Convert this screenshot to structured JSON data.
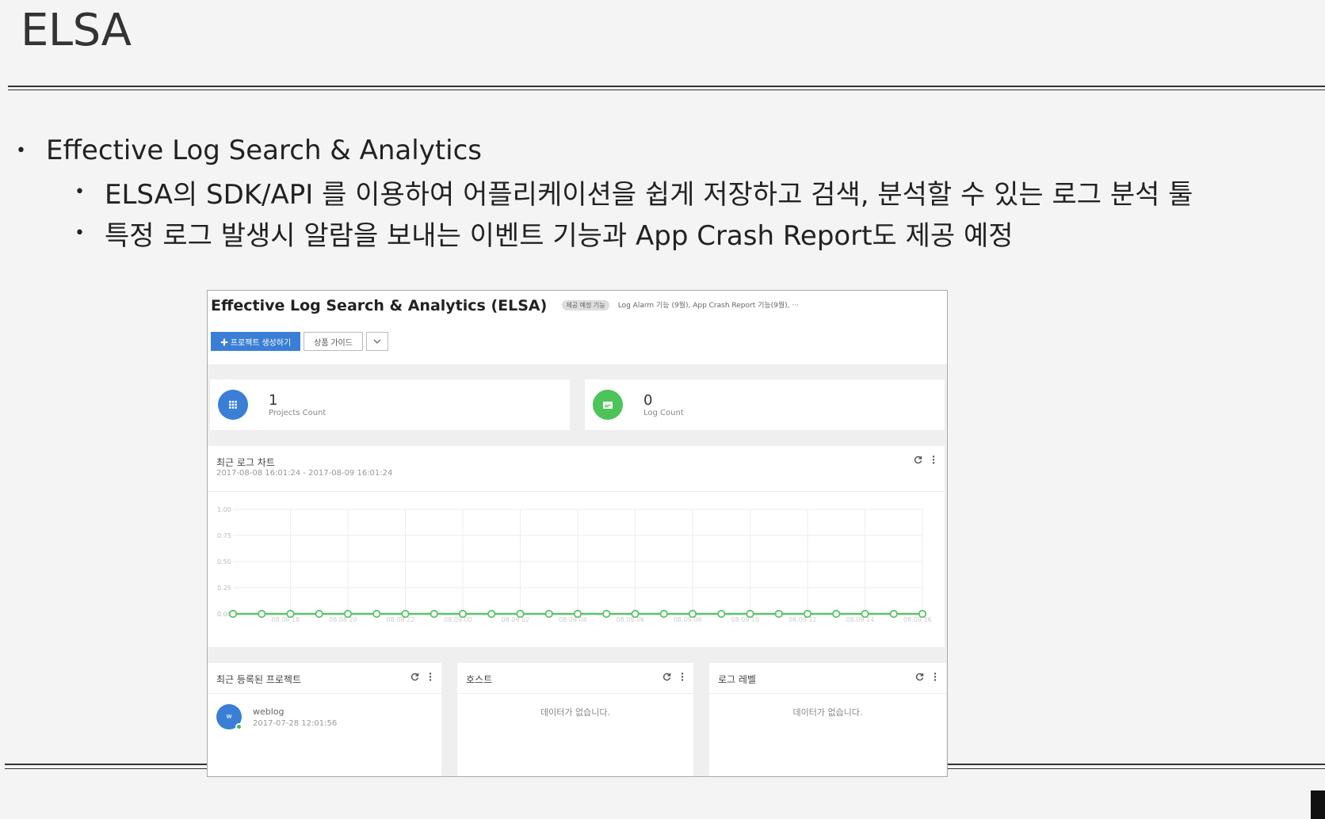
{
  "slide": {
    "title": "ELSA",
    "bullet_main": "Effective Log Search & Analytics",
    "bullet_subs": [
      "ELSA의 SDK/API 를 이용하여 어플리케이션을 쉽게 저장하고 검색, 분석할 수 있는 로그 분석 툴",
      "특정 로그 발생시 알람을 보내는 이벤트 기능과 App Crash Report도 제공 예정"
    ],
    "bullet_glyph": "•"
  },
  "screenshot": {
    "title": "Effective Log Search & Analytics (ELSA)",
    "tag": "제공 예정 기능",
    "note": "Log Alarm 기능 (9월), App Crash Report 기능(9월), ···",
    "create_button": "✚ 프로젝트 생성하기",
    "guide_button": "상품 가이드",
    "caret_icon": "chevron-down",
    "stats": [
      {
        "value": "1",
        "label": "Projects Count",
        "color": "#3a7fd5",
        "icon": "grid-icon"
      },
      {
        "value": "0",
        "label": "Log Count",
        "color": "#4cc45a",
        "icon": "log-icon"
      }
    ],
    "chart_card": {
      "title": "최근 로그 차트",
      "range": "2017-08-08 16:01:24 - 2017-08-09 16:01:24"
    },
    "bottom_cards": [
      {
        "title": "최근 등록된 프로젝트",
        "project": {
          "name": "weblog",
          "date": "2017-07-28 12:01:56",
          "avatar": "w"
        }
      },
      {
        "title": "호스트",
        "empty": "데이터가 없습니다."
      },
      {
        "title": "로그 레벨",
        "empty": "데이터가 없습니다."
      }
    ]
  },
  "chart_data": {
    "type": "line",
    "title": "최근 로그 차트",
    "ylim": [
      0,
      1
    ],
    "yticks": [
      "1.00",
      "0.75",
      "0.50",
      "0.25",
      "0.00"
    ],
    "xticks": [
      "08.08 18",
      "08.08 20",
      "08.08 22",
      "08.09 00",
      "08.09 02",
      "08.09 04",
      "08.09 06",
      "08.09 08",
      "08.09 10",
      "08.09 12",
      "08.09 14",
      "08.09 16"
    ],
    "series": [
      {
        "color": "#5cc26b",
        "values": [
          0,
          0,
          0,
          0,
          0,
          0,
          0,
          0,
          0,
          0,
          0,
          0,
          0,
          0,
          0,
          0,
          0,
          0,
          0,
          0,
          0,
          0,
          0,
          0,
          0
        ]
      }
    ],
    "grid": true
  }
}
